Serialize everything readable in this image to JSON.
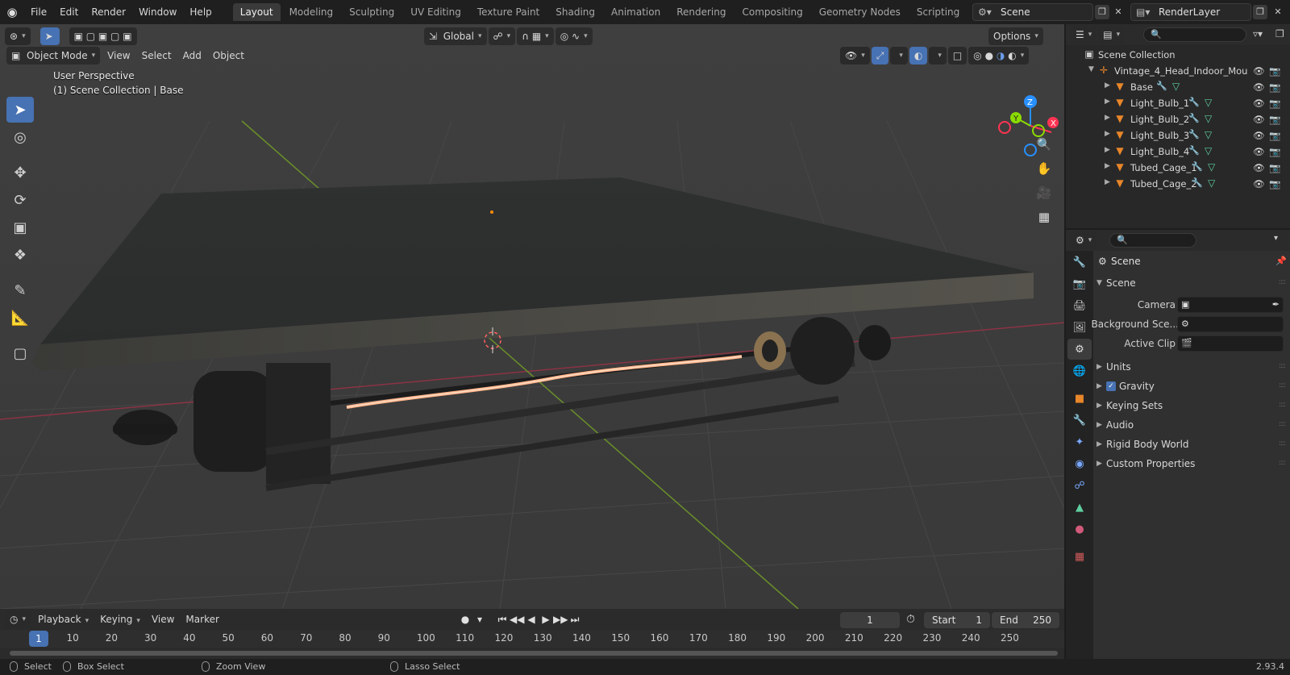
{
  "app": {
    "menus": [
      "File",
      "Edit",
      "Render",
      "Window",
      "Help"
    ],
    "workspaces": [
      "Layout",
      "Modeling",
      "Sculpting",
      "UV Editing",
      "Texture Paint",
      "Shading",
      "Animation",
      "Rendering",
      "Compositing",
      "Geometry Nodes",
      "Scripting"
    ],
    "active_workspace": "Layout",
    "scene_name": "Scene",
    "view_layer": "RenderLayer",
    "version": "2.93.4"
  },
  "viewport": {
    "mode": "Object Mode",
    "menus": [
      "View",
      "Select",
      "Add",
      "Object"
    ],
    "transform_orientation": "Global",
    "options_label": "Options",
    "info_line1": "User Perspective",
    "info_line2": "(1) Scene Collection | Base",
    "gizmo_axes": {
      "z": "Z",
      "y": "Y",
      "x": "X"
    }
  },
  "outliner": {
    "root": "Scene Collection",
    "collection": "Vintage_4_Head_Indoor_Mou",
    "objects": [
      "Base",
      "Light_Bulb_1",
      "Light_Bulb_2",
      "Light_Bulb_3",
      "Light_Bulb_4",
      "Tubed_Cage_1",
      "Tubed_Cage_2"
    ]
  },
  "properties": {
    "context": "Scene",
    "panel_title": "Scene",
    "camera_label": "Camera",
    "background_label": "Background Sce...",
    "active_clip_label": "Active Clip",
    "sections": [
      "Units",
      "Gravity",
      "Keying Sets",
      "Audio",
      "Rigid Body World",
      "Custom Properties"
    ],
    "gravity_checked": true
  },
  "timeline": {
    "menus": [
      "Playback",
      "Keying",
      "View",
      "Marker"
    ],
    "current_frame": "1",
    "start_label": "Start",
    "start": "1",
    "end_label": "End",
    "end": "250",
    "ticks": [
      "1",
      "10",
      "20",
      "30",
      "40",
      "50",
      "60",
      "70",
      "80",
      "90",
      "100",
      "110",
      "120",
      "130",
      "140",
      "150",
      "160",
      "170",
      "180",
      "190",
      "200",
      "210",
      "220",
      "230",
      "240",
      "250"
    ]
  },
  "statusbar": {
    "select": "Select",
    "box_select": "Box Select",
    "zoom_view": "Zoom View",
    "lasso_select": "Lasso Select"
  },
  "colors": {
    "accent": "#4772b3",
    "x_axis": "#ff3352",
    "y_axis": "#8bdc00",
    "z_axis": "#2890ff",
    "object_orange": "#e8862a"
  }
}
